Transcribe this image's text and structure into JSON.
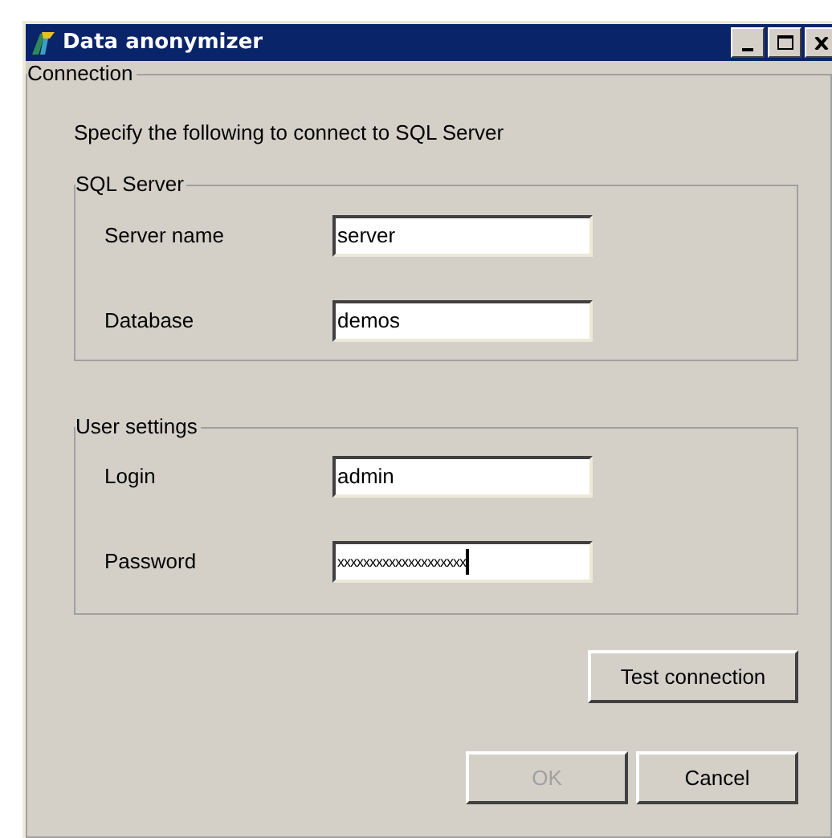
{
  "window": {
    "title": "Data anonymizer"
  },
  "connection": {
    "title": "Connection",
    "instruction": "Specify the following to connect to SQL Server",
    "groups": [
      {
        "title": "SQL Server",
        "fields": [
          {
            "label": "Server name",
            "value": "server",
            "focused": false
          },
          {
            "label": "Database",
            "value": "demos",
            "focused": false
          }
        ]
      },
      {
        "title": "User settings",
        "fields": [
          {
            "label": "Login",
            "value": "admin",
            "focused": false
          },
          {
            "label": "Password",
            "value": "xxxxxxxxxxxxxxxxxxxx",
            "focused": true
          }
        ]
      }
    ],
    "test_button": {
      "label": "Test connection",
      "disabled": false
    },
    "buttons": [
      {
        "label": "OK",
        "disabled": true
      },
      {
        "label": "Cancel",
        "disabled": false
      }
    ]
  }
}
